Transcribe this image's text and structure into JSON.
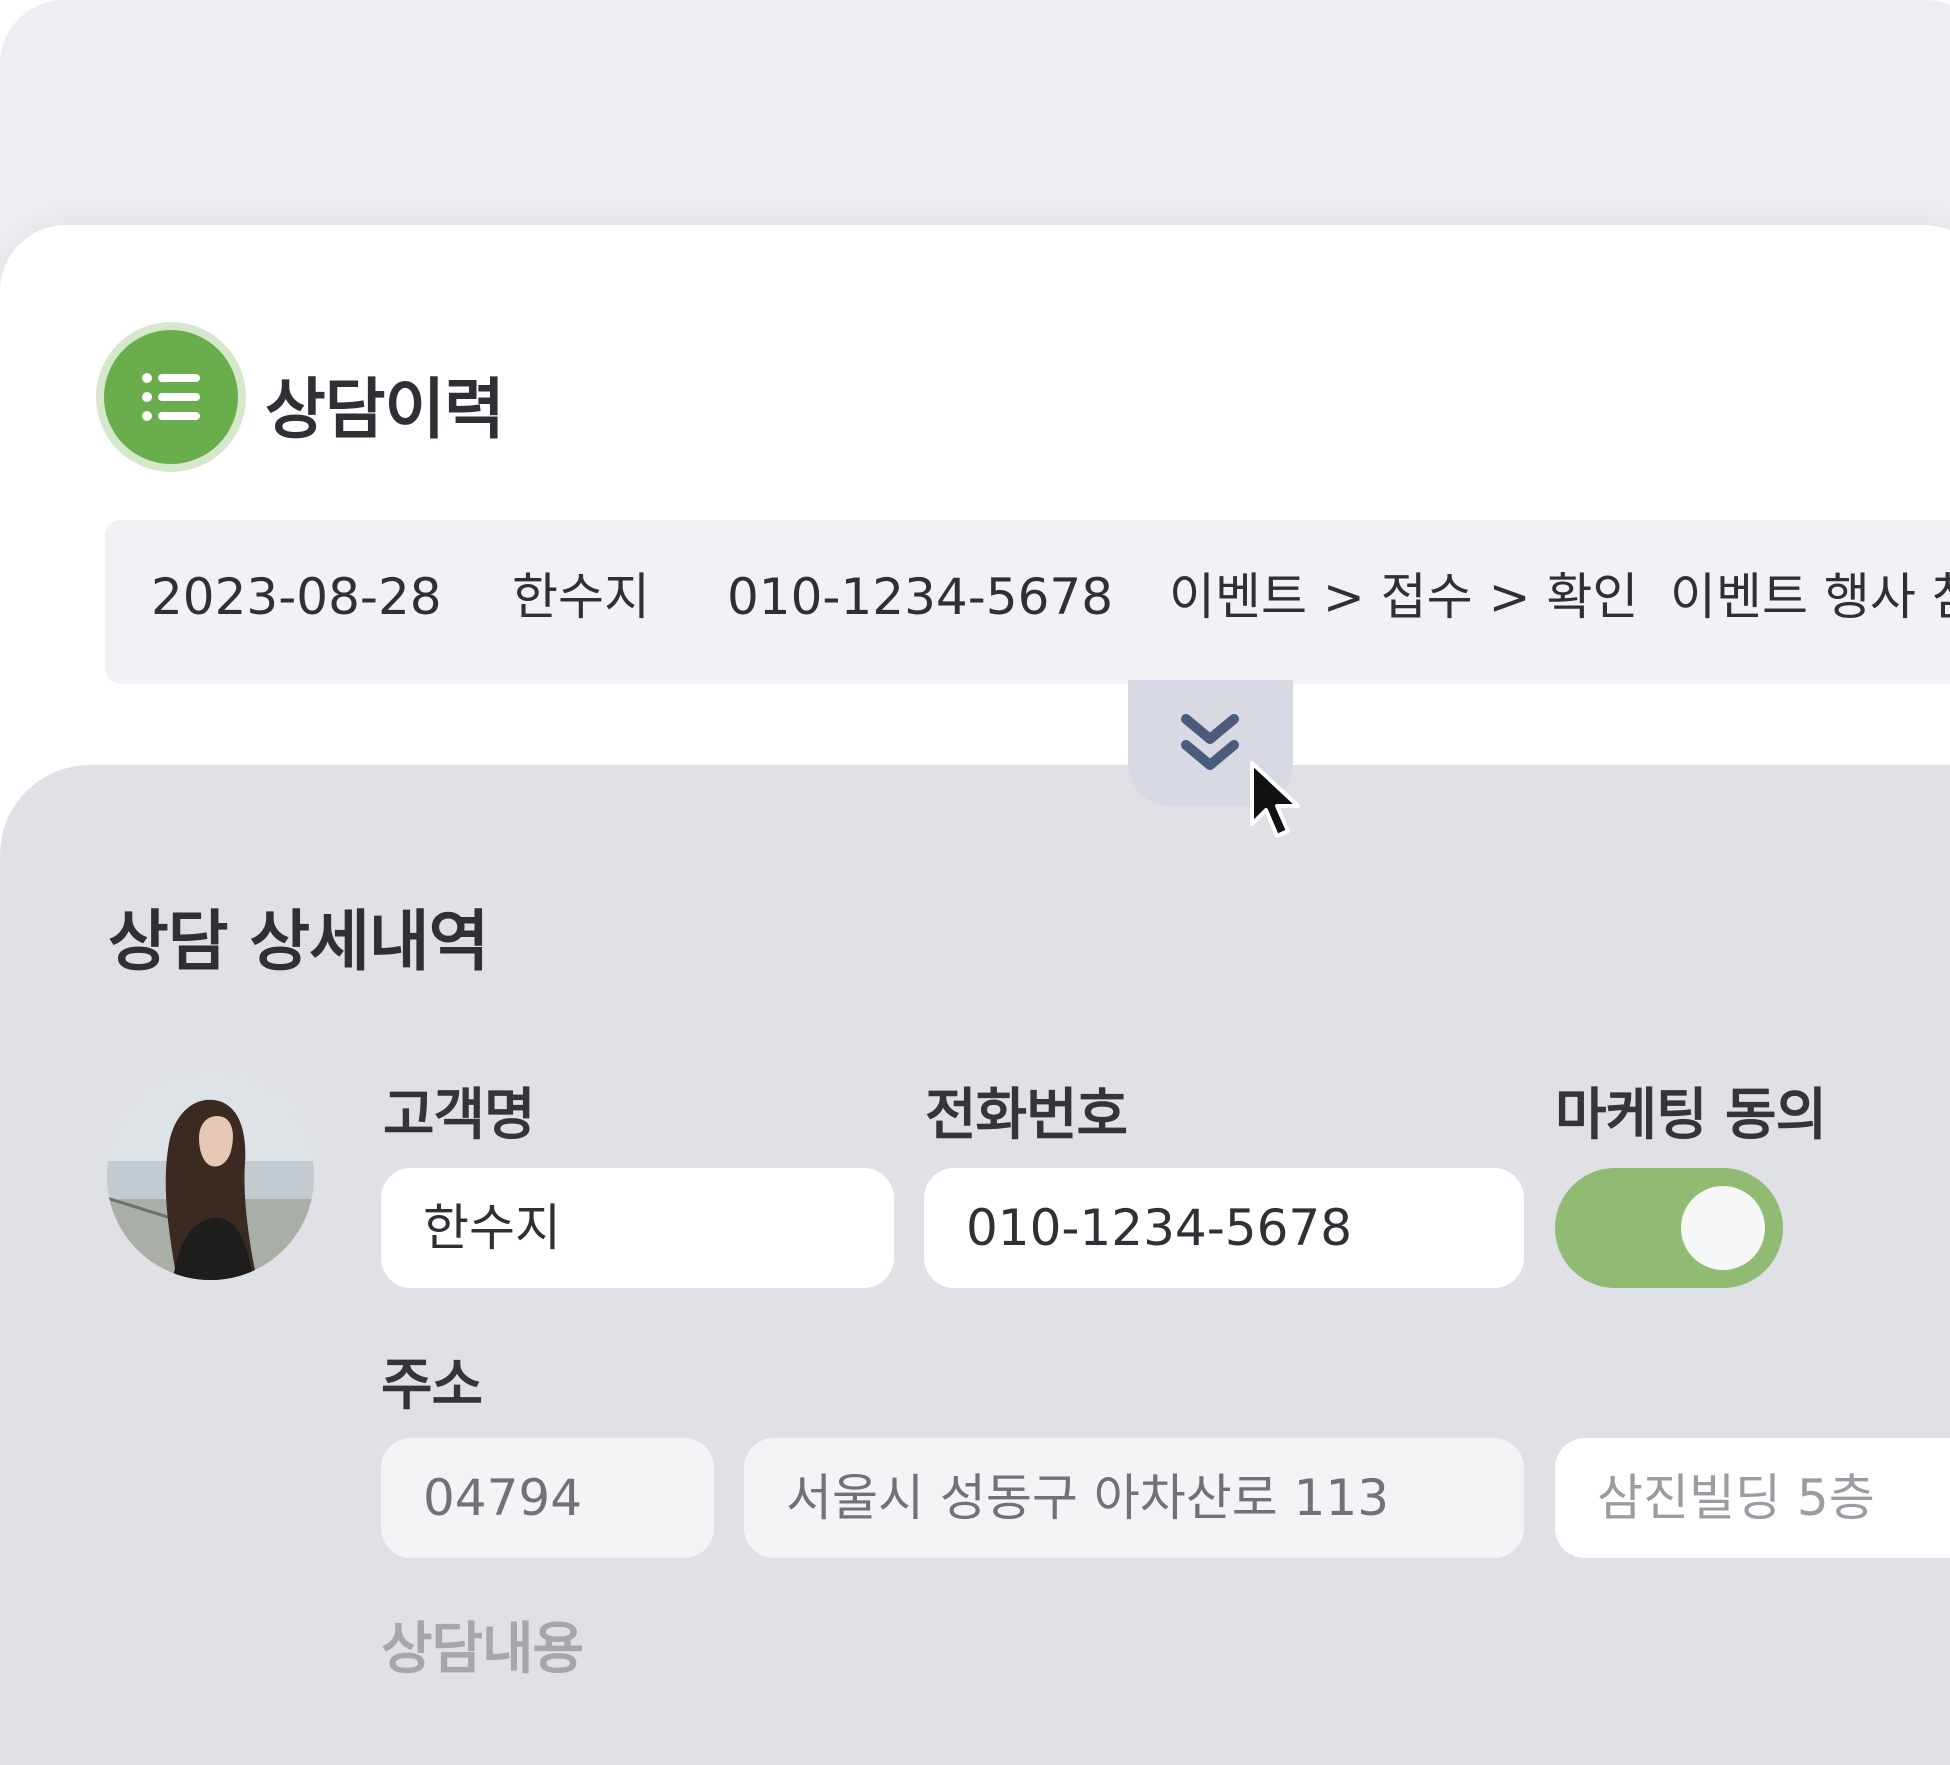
{
  "history": {
    "title": "상담이력",
    "row": {
      "date": "2023-08-28",
      "name": "한수지",
      "phone": "010-1234-5678",
      "category": "이벤트 > 접수 > 확인",
      "memo": "이벤트 행사 참"
    }
  },
  "detail": {
    "title": "상담 상세내역",
    "labels": {
      "customer_name": "고객명",
      "phone": "전화번호",
      "marketing": "마케팅 동의",
      "address": "주소",
      "content": "상담내용"
    },
    "values": {
      "customer_name": "한수지",
      "phone": "010-1234-5678",
      "marketing_agreed": true,
      "postal_code": "04794",
      "address_main": "서울시 성동구 아차산로 113",
      "address_detail": "삼진빌딩 5층"
    }
  },
  "icons": {
    "history": "list-icon",
    "expand": "double-chevron-down-icon",
    "cursor": "mouse-pointer-icon"
  },
  "colors": {
    "accent_green": "#6aad4c",
    "toggle_on": "#91bb73",
    "chevron": "#4a5b7c"
  }
}
